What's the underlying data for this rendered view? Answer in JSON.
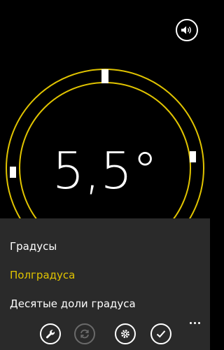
{
  "level": {
    "reading": "5,5°"
  },
  "menu": {
    "items": [
      {
        "label": "Градусы",
        "selected": false
      },
      {
        "label": "Полградуса",
        "selected": true
      },
      {
        "label": "Десятые доли градуса",
        "selected": false
      }
    ]
  },
  "appbar": {
    "buttons": [
      {
        "icon": "wrench-icon",
        "enabled": true
      },
      {
        "icon": "refresh-icon",
        "enabled": false
      },
      {
        "icon": "settings-icon",
        "enabled": true
      },
      {
        "icon": "check-icon",
        "enabled": true
      }
    ],
    "more": "more-icon"
  },
  "colors": {
    "accent": "#e1c400",
    "background": "#000000",
    "menu_background": "#2a2a2a"
  }
}
